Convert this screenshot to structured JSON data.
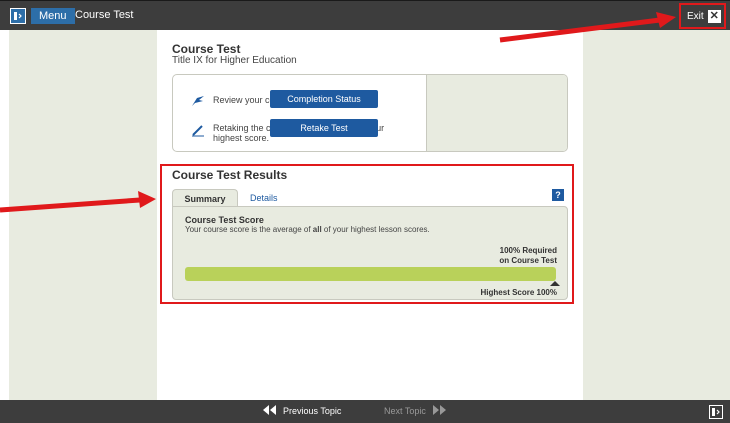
{
  "topbar": {
    "menu_label": "Menu",
    "breadcrumb": "Course Test",
    "exit_label": "Exit",
    "exit_icon": "close-icon"
  },
  "course": {
    "title": "Course Test",
    "subtitle": "Title IX for Higher Education"
  },
  "info": {
    "row1": "Review your course completion status.",
    "row2": "Retaking the course test will not lower your highest score.",
    "completion_button": "Completion Status",
    "retake_button": "Retake Test"
  },
  "results": {
    "title": "Course Test Results",
    "tabs": [
      "Summary",
      "Details"
    ],
    "help": "?",
    "score_title": "Course Test Score",
    "score_desc_pre": "Your course score is the average of ",
    "score_desc_bold": "all",
    "score_desc_post": " of your highest lesson scores.",
    "required_line1": "100% Required",
    "required_line2": "on Course Test",
    "highest_score_text": "Highest Score 100%",
    "progress_percent": 100
  },
  "footer": {
    "prev": "Previous Topic",
    "next": "Next Topic"
  },
  "colors": {
    "accent": "#1e5aa0",
    "bar": "#b9d15a",
    "annotation": "#e0191b",
    "chrome": "#3d3d3d",
    "panel": "#e8ebe0"
  }
}
